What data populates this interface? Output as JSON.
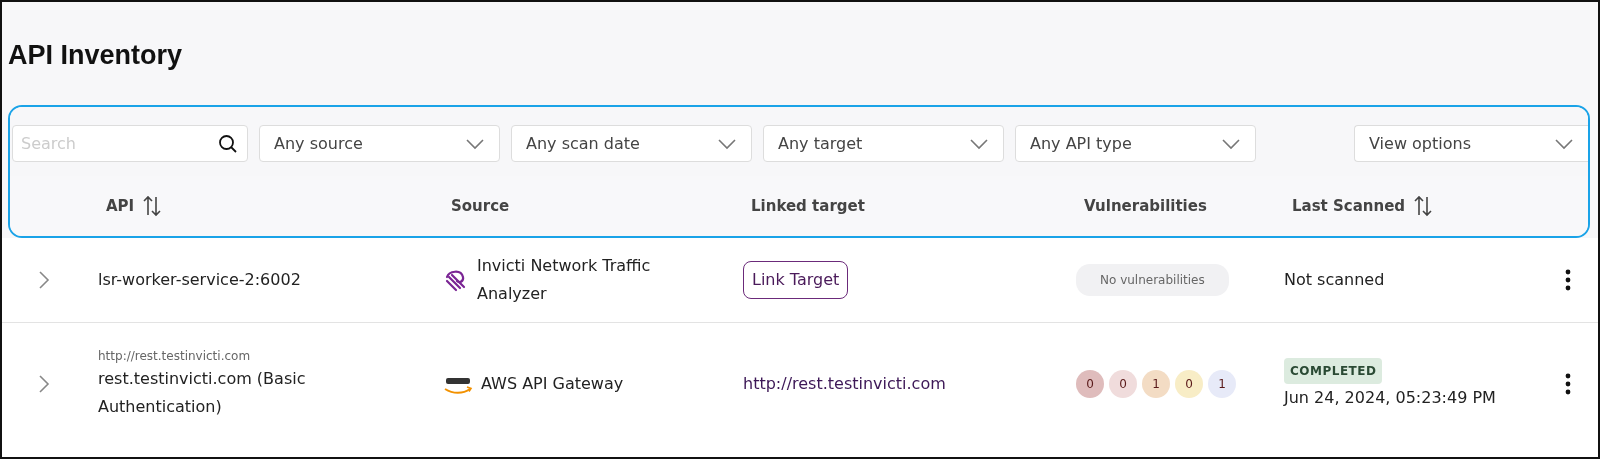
{
  "title": "API Inventory",
  "search": {
    "placeholder": "Search"
  },
  "filters": [
    "Any source",
    "Any scan date",
    "Any target",
    "Any API type"
  ],
  "view_options": "View options",
  "columns": [
    {
      "label": "API",
      "sortable": true
    },
    {
      "label": "Source",
      "sortable": false
    },
    {
      "label": "Linked target",
      "sortable": false
    },
    {
      "label": "Vulnerabilities",
      "sortable": false
    },
    {
      "label": "Last Scanned",
      "sortable": true
    }
  ],
  "rows": [
    {
      "url": "",
      "api": "lsr-worker-service-2:6002",
      "source": {
        "kind": "traffic",
        "name": "Invicti Network Traffic Analyzer"
      },
      "target": {
        "kind": "button",
        "text": "Link Target"
      },
      "vulns": {
        "kind": "none",
        "text": "No vulnerabilities"
      },
      "status": "",
      "last_scanned": "Not scanned"
    },
    {
      "url": "http://rest.testinvicti.com",
      "api": "rest.testinvicti.com (Basic Authentication)",
      "source": {
        "kind": "aws",
        "name": "AWS API Gateway"
      },
      "target": {
        "kind": "link",
        "text": "http://rest.testinvicti.com"
      },
      "vulns": {
        "kind": "counts",
        "counts": [
          {
            "count": "0",
            "color": "#dfbcbc"
          },
          {
            "count": "0",
            "color": "#f0dcdc"
          },
          {
            "count": "1",
            "color": "#f3dcc4"
          },
          {
            "count": "0",
            "color": "#f8edc6"
          },
          {
            "count": "1",
            "color": "#e7eaf8"
          }
        ]
      },
      "status": "COMPLETED",
      "last_scanned": "Jun 24, 2024, 05:23:49 PM"
    }
  ]
}
